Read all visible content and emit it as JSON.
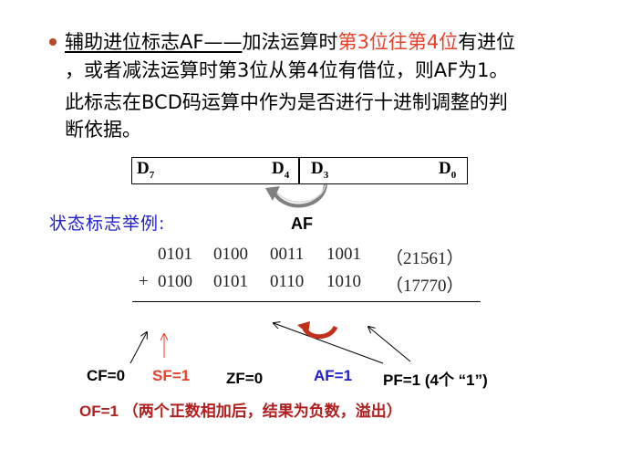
{
  "paragraph": {
    "l1_a": "辅助进位标志AF——",
    "l1_b": "加法运算时",
    "l1_c": "第3位往第4位",
    "l1_d": "有进位",
    "l2": "，或者减法运算时第3位从第4位有借位，则AF为1。",
    "l3": "此标志在BCD码运算中作为是否进行十进制调整的判",
    "l4": "断依据。"
  },
  "register": {
    "d7": "D",
    "d7_sub": "7",
    "d4": "D",
    "d4_sub": "4",
    "d3": "D",
    "d3_sub": "3",
    "d0": "D",
    "d0_sub": "0"
  },
  "af_label": "AF",
  "status_title": "状态标志举例:",
  "addition": {
    "row1": [
      "0101",
      "0100",
      "0011",
      "1001",
      "（21561）"
    ],
    "plus": "+",
    "row2": [
      "0100",
      "0101",
      "0110",
      "1010",
      "（17770）"
    ]
  },
  "flags": {
    "cf": "CF=0",
    "sf": "SF=1",
    "zf": "ZF=0",
    "af": "AF=1",
    "pf": "PF=1 (4个 “1”)",
    "of": "OF=1 （两个正数相加后，结果为负数，溢出）"
  },
  "colors": {
    "red": "#e8412a",
    "blue": "#2020d0",
    "dark_red": "#b01e1e",
    "bullet": "#b8472a"
  }
}
